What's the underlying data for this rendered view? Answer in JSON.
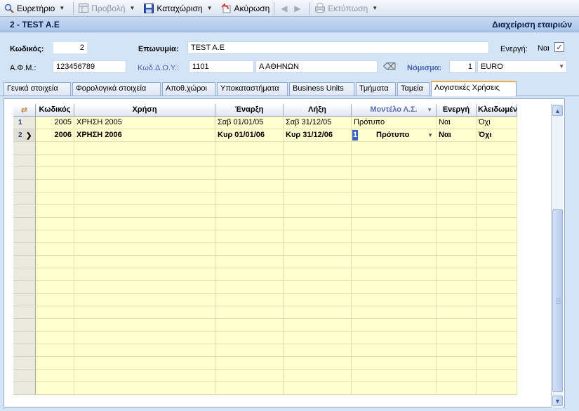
{
  "toolbar": {
    "items": [
      {
        "label": "Ευρετήριο",
        "icon": "search-icon",
        "dropdown": true,
        "enabled": true
      },
      {
        "label": "Προβολή",
        "icon": "view-icon",
        "dropdown": true,
        "enabled": false
      },
      {
        "label": "Καταχώριση",
        "icon": "save-icon",
        "dropdown": true,
        "enabled": true
      },
      {
        "label": "Ακύρωση",
        "icon": "undo-icon",
        "dropdown": false,
        "enabled": true
      },
      {
        "label": "Εκτύπωση",
        "icon": "print-icon",
        "dropdown": true,
        "enabled": false
      }
    ]
  },
  "title": {
    "left": "2 - TEST A.E",
    "right": "Διαχείριση εταιριών"
  },
  "form": {
    "code_label": "Κωδικός:",
    "code_value": "2",
    "name_label": "Επωνυμία:",
    "name_value": "TEST A.E",
    "active_label": "Ενεργή:",
    "active_value": "Ναι",
    "active_checked": true,
    "afm_label": "Α.Φ.Μ.:",
    "afm_value": "123456789",
    "doy_label": "Κωδ.Δ.Ο.Υ.:",
    "doy_code": "1101",
    "doy_name": "Α ΑΘΗΝΩΝ",
    "currency_label": "Νόμισμα:",
    "currency_code": "1",
    "currency_name": "EURO"
  },
  "tabs": [
    {
      "label": "Γενικά στοιχεία",
      "active": false
    },
    {
      "label": "Φορολογικά στοιχεία",
      "active": false
    },
    {
      "label": "Αποθ.χώροι",
      "active": false
    },
    {
      "label": "Υποκαταστήματα",
      "active": false
    },
    {
      "label": "Business Units",
      "active": false
    },
    {
      "label": "Τμήματα",
      "active": false
    },
    {
      "label": "Ταμεία",
      "active": false
    },
    {
      "label": "Λογιστικές Χρήσεις",
      "active": true
    }
  ],
  "grid": {
    "columns": [
      "Κωδικός",
      "Χρήση",
      "Έναρξη",
      "Λήξη",
      "Μοντέλο Λ.Σ.",
      "Ενεργή",
      "Κλειδωμένη"
    ],
    "rows": [
      {
        "num": "1",
        "code": "2005",
        "name": "ΧΡΗΣΗ 2005",
        "start": "Σαβ 01/01/05",
        "end": "Σαβ 31/12/05",
        "model": "Πρότυπο",
        "active": "Ναι",
        "locked": "Όχι",
        "current": false
      },
      {
        "num": "2",
        "code": "2006",
        "name": "ΧΡΗΣΗ 2006",
        "start": "Κυρ 01/01/06",
        "end": "Κυρ 31/12/06",
        "model_edit": "1",
        "model": "Πρότυπο",
        "active": "Ναι",
        "locked": "Όχι",
        "current": true
      }
    ],
    "empty_rows": 20
  }
}
